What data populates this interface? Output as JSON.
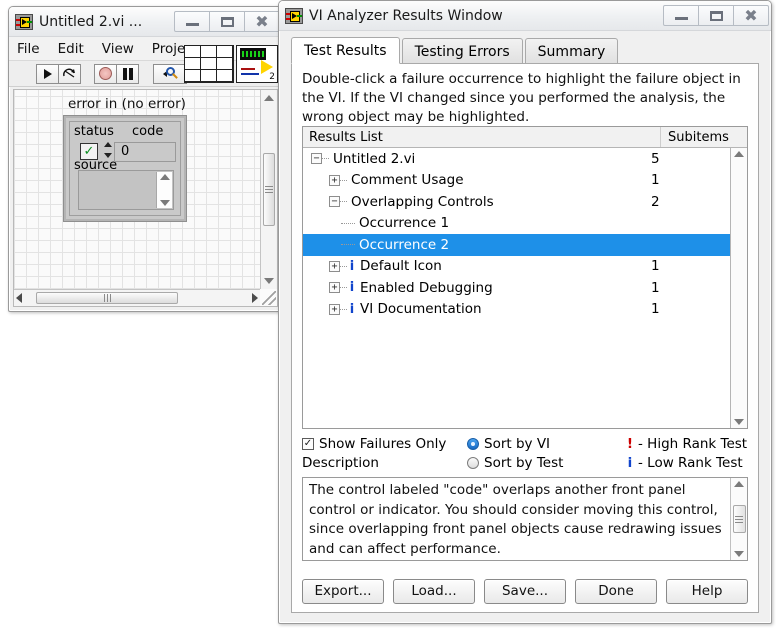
{
  "vi_window": {
    "title": "Untitled 2.vi ...",
    "icon": "labview-vi-icon",
    "window_buttons": [
      "minimize",
      "maximize",
      "close"
    ],
    "menus": [
      "File",
      "Edit",
      "View",
      "Proje"
    ],
    "toolbar": {
      "run": "run-arrow-icon",
      "run_continuously": "run-continuously-icon",
      "abort": "abort-execution-icon",
      "pause": "pause-icon",
      "text_settings": "search-magnifier-icon",
      "grid": "align-grid-icon",
      "connector": "connector-pane-icon",
      "connector_badge": "2"
    },
    "front_panel": {
      "cluster_label": "error in (no error)",
      "status_label": "status",
      "code_label": "code",
      "source_label": "source",
      "status_value": "✓",
      "code_value": "0",
      "source_value": ""
    }
  },
  "analyzer_window": {
    "title": "VI Analyzer Results Window",
    "icon": "labview-vi-icon",
    "window_buttons": [
      "minimize",
      "maximize",
      "close"
    ],
    "tabs": [
      {
        "label": "Test Results",
        "active": true
      },
      {
        "label": "Testing Errors",
        "active": false
      },
      {
        "label": "Summary",
        "active": false
      }
    ],
    "hint": "Double-click a failure occurrence to highlight the failure object in the VI.  If the VI changed since you performed the analysis, the wrong object may be highlighted.",
    "results": {
      "columns": [
        "Results List",
        "Subitems"
      ],
      "rows": [
        {
          "label": "Untitled 2.vi",
          "subitems": "5",
          "depth": 0,
          "expander": "minus",
          "info": false,
          "selected": false
        },
        {
          "label": "Comment Usage",
          "subitems": "1",
          "depth": 1,
          "expander": "plus",
          "info": false,
          "selected": false
        },
        {
          "label": "Overlapping Controls",
          "subitems": "2",
          "depth": 1,
          "expander": "minus",
          "info": false,
          "selected": false
        },
        {
          "label": "Occurrence 1",
          "subitems": "",
          "depth": 2,
          "expander": "none",
          "info": false,
          "selected": false
        },
        {
          "label": "Occurrence 2",
          "subitems": "",
          "depth": 2,
          "expander": "none",
          "info": false,
          "selected": true
        },
        {
          "label": "Default Icon",
          "subitems": "1",
          "depth": 1,
          "expander": "plus",
          "info": true,
          "selected": false
        },
        {
          "label": "Enabled Debugging",
          "subitems": "1",
          "depth": 1,
          "expander": "plus",
          "info": true,
          "selected": false
        },
        {
          "label": "VI Documentation",
          "subitems": "1",
          "depth": 1,
          "expander": "plus",
          "info": true,
          "selected": false
        }
      ]
    },
    "options": {
      "show_failures_only_label": "Show Failures Only",
      "show_failures_only_checked": "✓",
      "description_label": "Description",
      "sort_by_vi_label": "Sort by VI",
      "sort_by_test_label": "Sort by Test",
      "sort_selected": "Sort by VI",
      "legend_high": "- High Rank Test",
      "legend_low": "- Low Rank Test",
      "legend_high_glyph": "!",
      "legend_low_glyph": "i"
    },
    "description_text": "The control labeled \"code\" overlaps another front panel control or indicator.  You should consider moving this control, since overlapping front panel objects cause redrawing issues and can affect performance.",
    "buttons": [
      "Export...",
      "Load...",
      "Save...",
      "Done",
      "Help"
    ]
  },
  "colors": {
    "selection_blue": "#1e90e8",
    "info_blue": "#1145cc",
    "high_rank_red": "#cc0000",
    "status_green": "#0a8f20",
    "window_bg": "#f0f0f0"
  }
}
